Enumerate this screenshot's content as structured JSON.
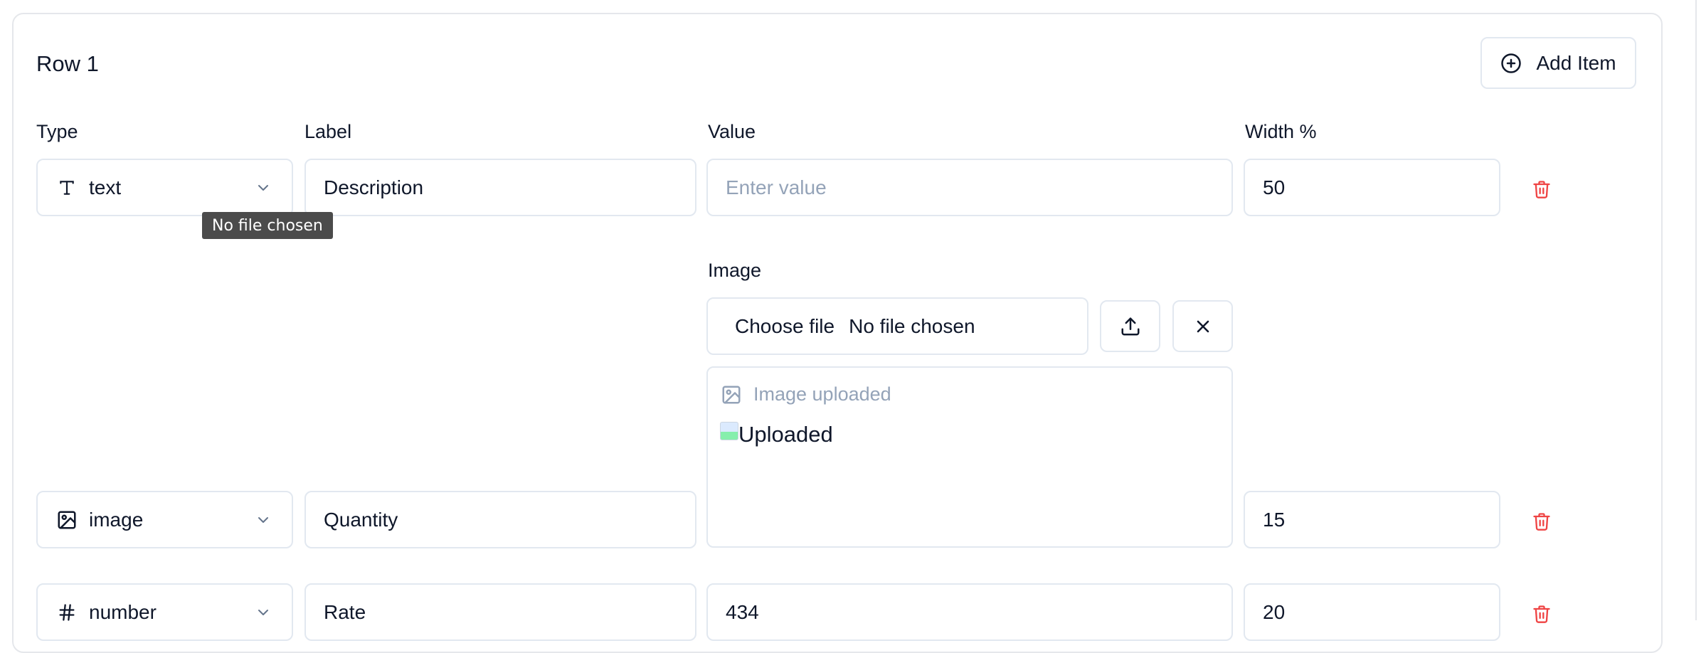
{
  "row": {
    "title": "Row 1",
    "add_item_label": "Add Item"
  },
  "columns": {
    "type": "Type",
    "label": "Label",
    "value": "Value",
    "width": "Width %"
  },
  "items": [
    {
      "type": "text",
      "type_icon": "text-type-icon",
      "label": "Description",
      "value": "",
      "value_placeholder": "Enter value",
      "width": "50"
    },
    {
      "type": "image",
      "type_icon": "image-type-icon",
      "label": "Quantity",
      "width": "15"
    },
    {
      "type": "number",
      "type_icon": "hash-icon",
      "label": "Rate",
      "value": "434",
      "width": "20"
    }
  ],
  "image_field": {
    "label": "Image",
    "choose_file": "Choose file",
    "file_status": "No file chosen",
    "preview_hint": "Image uploaded",
    "image_alt": "Uploaded"
  },
  "tooltip": "No file chosen",
  "colors": {
    "border": "#e2e8f0",
    "placeholder": "#94a3b8",
    "danger": "#ef4444",
    "tooltip_bg": "#4b4b4b"
  }
}
